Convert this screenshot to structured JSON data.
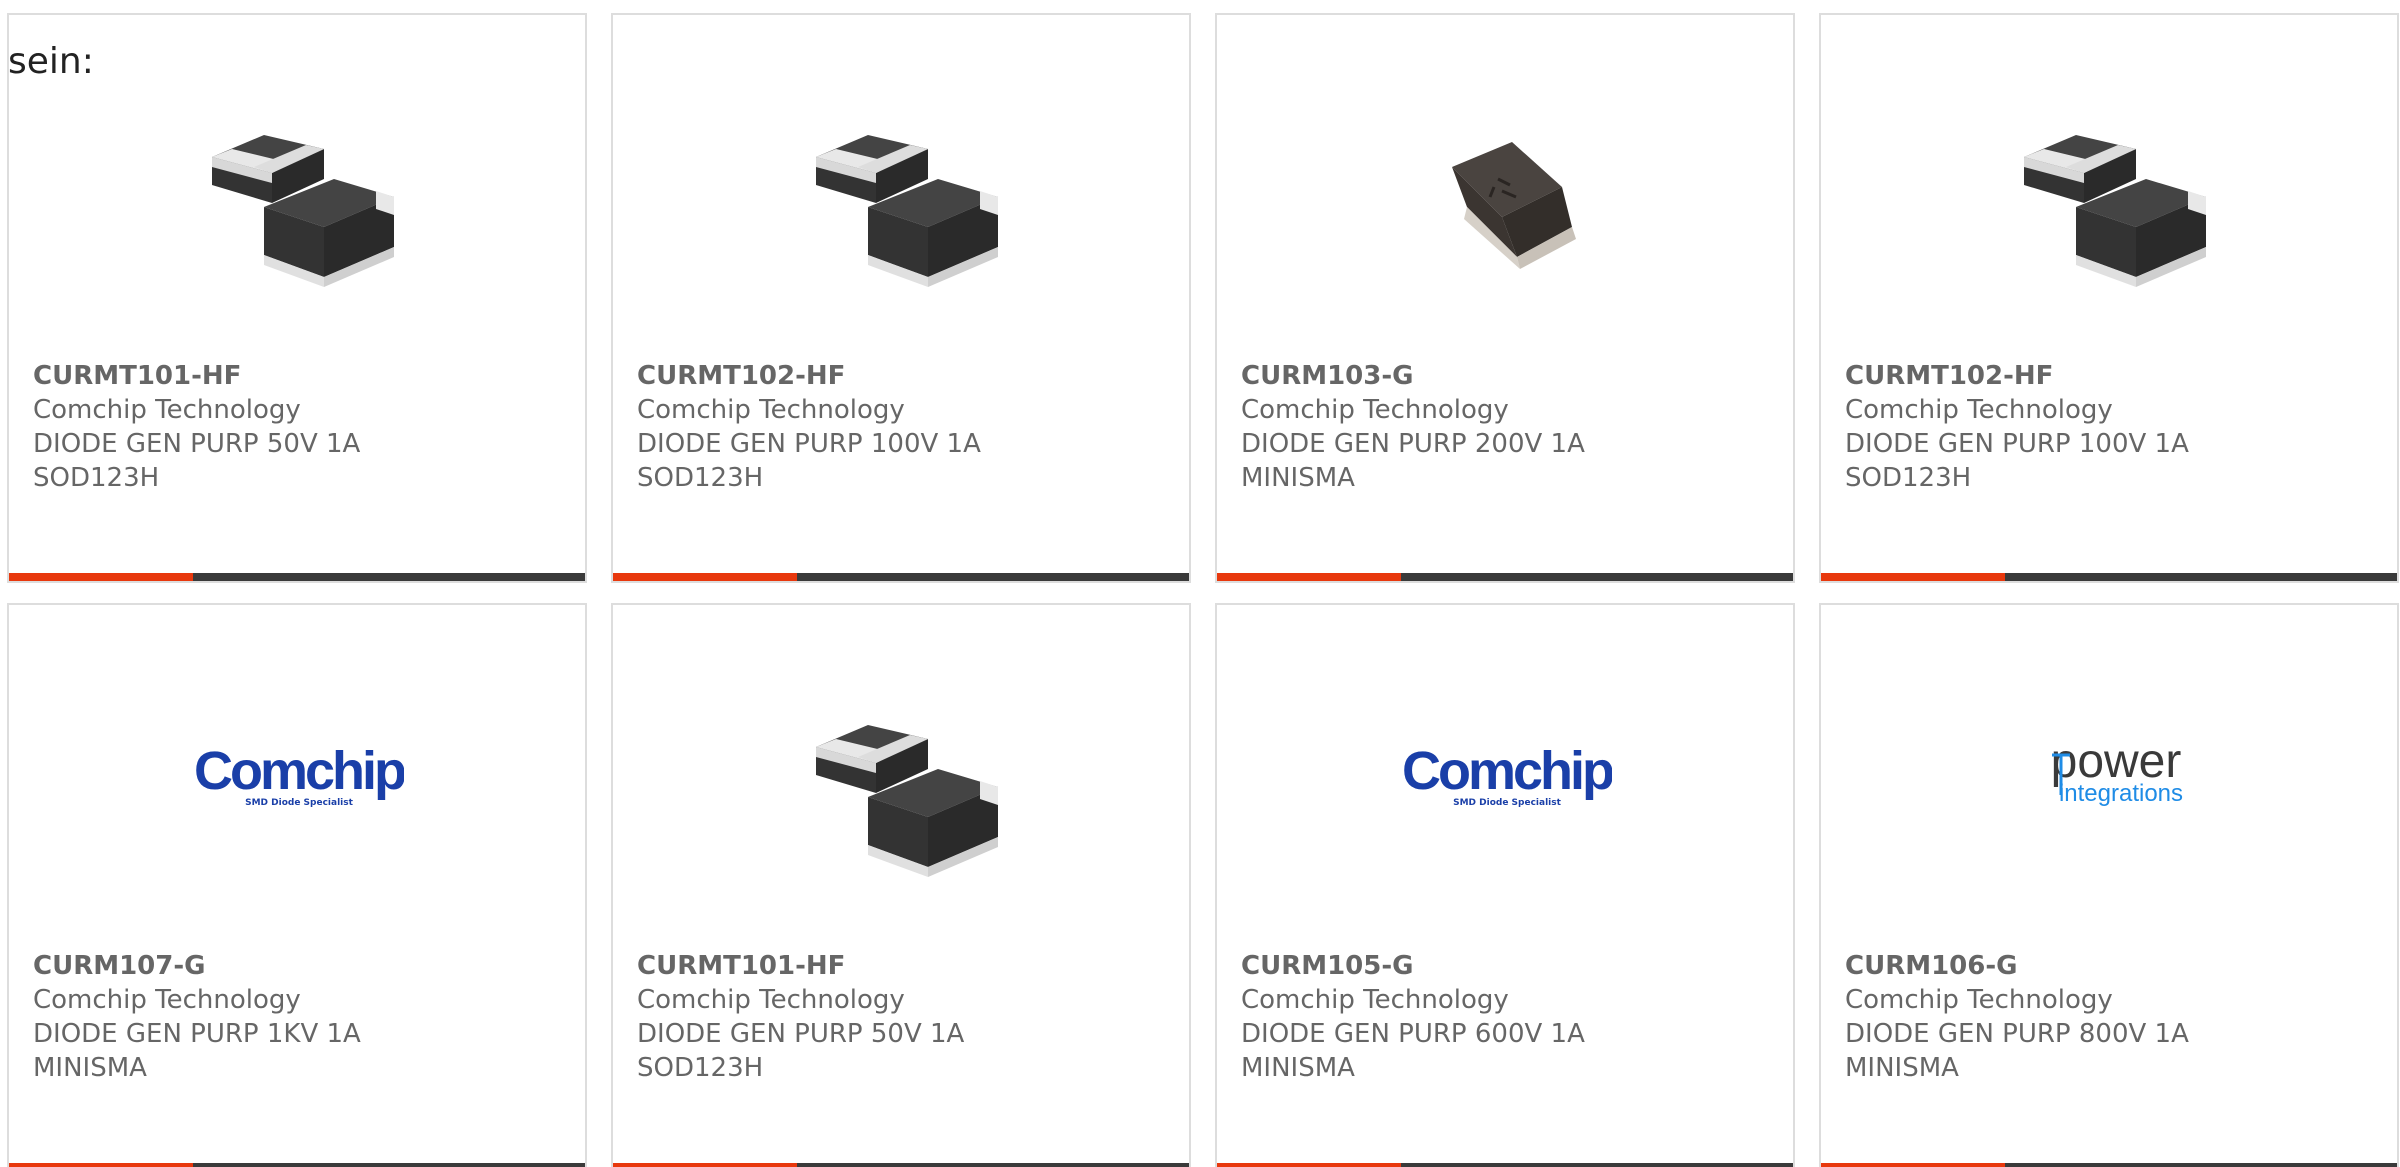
{
  "intro_text": "sein:",
  "colors": {
    "accent": "#e8380d",
    "bar_dark": "#3a3a3a",
    "text_gray": "#666666",
    "border": "#dddddd",
    "comchip_blue": "#1a3fa8",
    "power_blue": "#1f8ce6"
  },
  "products": [
    {
      "part_number": "CURMT101-HF",
      "manufacturer": "Comchip Technology",
      "description": "DIODE GEN PURP 50V 1A",
      "package": "SOD123H",
      "image": "sod123h-diode-photo"
    },
    {
      "part_number": "CURMT102-HF",
      "manufacturer": "Comchip Technology",
      "description": "DIODE GEN PURP 100V 1A",
      "package": "SOD123H",
      "image": "sod123h-diode-photo"
    },
    {
      "part_number": "CURM103-G",
      "manufacturer": "Comchip Technology",
      "description": "DIODE GEN PURP 200V 1A",
      "package": "MINISMA",
      "image": "minisma-diode-photo"
    },
    {
      "part_number": "CURMT102-HF",
      "manufacturer": "Comchip Technology",
      "description": "DIODE GEN PURP 100V 1A",
      "package": "SOD123H",
      "image": "sod123h-diode-photo"
    },
    {
      "part_number": "CURM107-G",
      "manufacturer": "Comchip Technology",
      "description": "DIODE GEN PURP 1KV 1A",
      "package": "MINISMA",
      "image": "comchip-logo",
      "logo_text": "Comchip",
      "logo_tagline": "SMD Diode Specialist"
    },
    {
      "part_number": "CURMT101-HF",
      "manufacturer": "Comchip Technology",
      "description": "DIODE GEN PURP 50V 1A",
      "package": "SOD123H",
      "image": "sod123h-diode-photo"
    },
    {
      "part_number": "CURM105-G",
      "manufacturer": "Comchip Technology",
      "description": "DIODE GEN PURP 600V 1A",
      "package": "MINISMA",
      "image": "comchip-logo",
      "logo_text": "Comchip",
      "logo_tagline": "SMD Diode Specialist"
    },
    {
      "part_number": "CURM106-G",
      "manufacturer": "Comchip Technology",
      "description": "DIODE GEN PURP 800V 1A",
      "package": "MINISMA",
      "image": "power-integrations-logo",
      "logo_text": "power",
      "logo_tagline": "integrations"
    }
  ]
}
